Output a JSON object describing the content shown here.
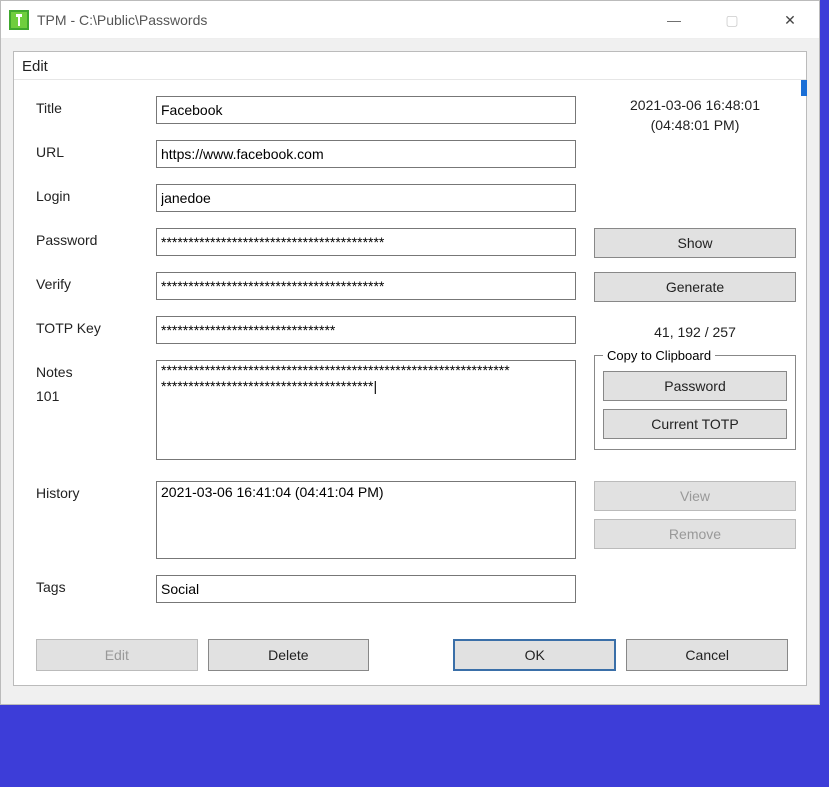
{
  "window": {
    "title": "TPM - C:\\Public\\Passwords",
    "min_label": "—",
    "max_label": "▢",
    "close_label": "✕"
  },
  "panel": {
    "header": "Edit"
  },
  "labels": {
    "title": "Title",
    "url": "URL",
    "login": "Login",
    "password": "Password",
    "verify": "Verify",
    "totp_key": "TOTP Key",
    "notes": "Notes",
    "notes_count": "101",
    "history": "History",
    "tags": "Tags"
  },
  "fields": {
    "title": "Facebook",
    "url": "https://www.facebook.com",
    "login": "janedoe",
    "password": "*****************************************",
    "verify": "*****************************************",
    "totp_key": "********************************",
    "notes": "****************************************************************\n***************************************|",
    "tags": "Social"
  },
  "timestamp": {
    "line1": "2021-03-06 16:48:01",
    "line2": "(04:48:01 PM)"
  },
  "buttons": {
    "show": "Show",
    "generate": "Generate",
    "clipboard_password": "Password",
    "clipboard_totp": "Current TOTP",
    "view": "View",
    "remove": "Remove",
    "edit": "Edit",
    "delete": "Delete",
    "ok": "OK",
    "cancel": "Cancel"
  },
  "counter": "41, 192 / 257",
  "clipboard_legend": "Copy to Clipboard",
  "history_items": [
    "2021-03-06 16:41:04 (04:41:04 PM)"
  ]
}
